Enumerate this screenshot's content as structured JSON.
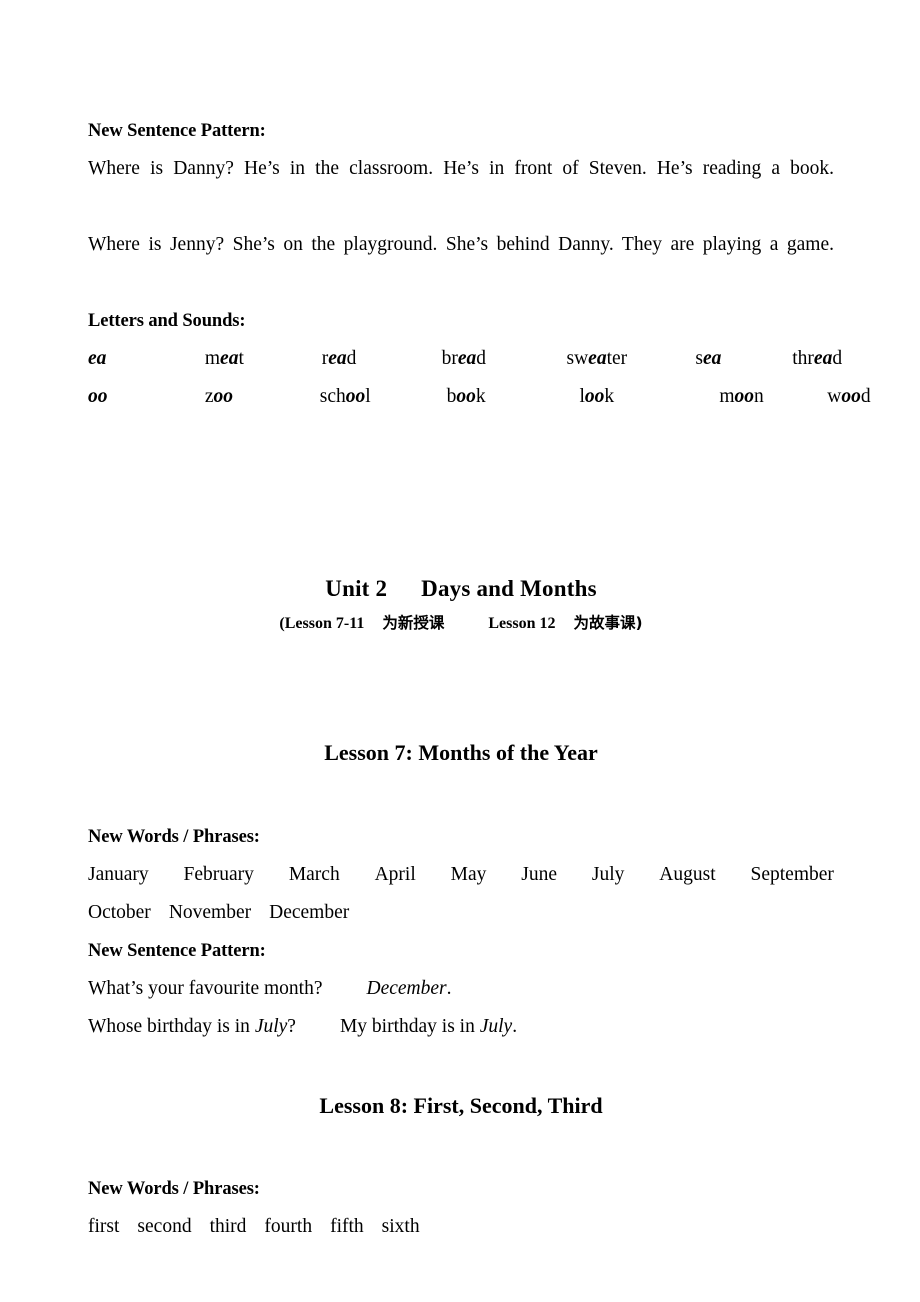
{
  "document": {
    "sections": [
      {
        "id": "unit1-tail",
        "sentence_pattern_label": "New Sentence Pattern:",
        "sentence_lines": [
          "Where is Danny? He’s in the classroom. He’s in front of Steven. He’s reading a book.",
          "Where is Jenny? She’s on the playground. She’s behind Danny. They are playing a game."
        ],
        "letters_sounds_label": "Letters and Sounds:",
        "phonics": [
          {
            "key": "ea",
            "words": [
              {
                "pre": "m",
                "dig": "ea",
                "post": "t"
              },
              {
                "pre": "r",
                "dig": "ea",
                "post": "d"
              },
              {
                "pre": "br",
                "dig": "ea",
                "post": "d"
              },
              {
                "pre": "sw",
                "dig": "ea",
                "post": "ter"
              },
              {
                "pre": "s",
                "dig": "ea",
                "post": ""
              },
              {
                "pre": "thr",
                "dig": "ea",
                "post": "d"
              }
            ]
          },
          {
            "key": "oo",
            "words": [
              {
                "pre": "z",
                "dig": "oo",
                "post": ""
              },
              {
                "pre": "sch",
                "dig": "oo",
                "post": "l"
              },
              {
                "pre": "b",
                "dig": "oo",
                "post": "k"
              },
              {
                "pre": "l",
                "dig": "oo",
                "post": "k"
              },
              {
                "pre": "m",
                "dig": "oo",
                "post": "n"
              },
              {
                "pre": "w",
                "dig": "oo",
                "post": "d"
              }
            ]
          }
        ]
      }
    ],
    "unit": {
      "title_number": "Unit 2",
      "title_name": "Days and Months",
      "subtitle_open": "(Lesson 7-11",
      "subtitle_cn_1": "为新授课",
      "subtitle_mid": "Lesson 12",
      "subtitle_cn_2": "为故事课)"
    },
    "lesson7": {
      "heading": "Lesson 7: Months of the Year",
      "words_label": "New Words / Phrases:",
      "months_line_1": [
        "January",
        "February",
        "March",
        "April",
        "May",
        "June",
        "July",
        "August",
        "September"
      ],
      "months_line_2": [
        "October",
        "November",
        "December"
      ],
      "sentence_label": "New Sentence Pattern:",
      "pattern_1": {
        "question": "What’s your favourite month?",
        "answer_italic": "December",
        "answer_tail": "."
      },
      "pattern_2": {
        "q_lead": "Whose birthday is in ",
        "q_italic": "July",
        "q_tail": "?",
        "a_lead": "My birthday is in ",
        "a_italic": "July",
        "a_tail": "."
      }
    },
    "lesson8": {
      "heading": "Lesson 8: First, Second, Third",
      "words_label": "New Words / Phrases:",
      "ordinals": [
        "first",
        "second",
        "third",
        "fourth",
        "fifth",
        "sixth"
      ]
    },
    "colors": {
      "page_background": "#ffffff",
      "text": "#000000"
    }
  }
}
